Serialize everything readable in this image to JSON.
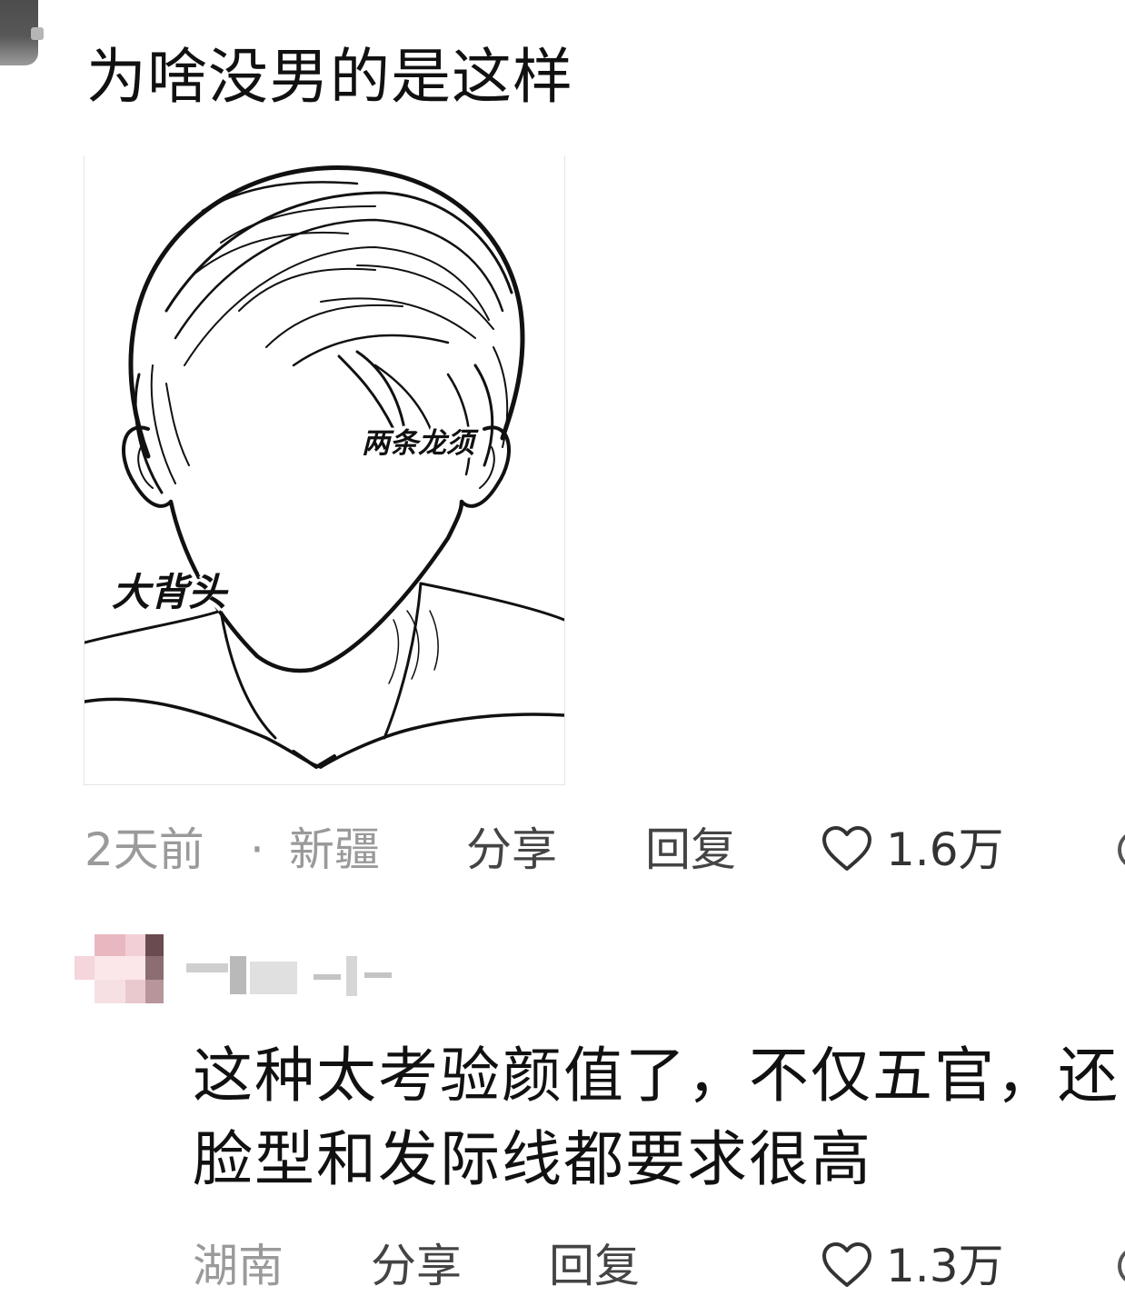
{
  "post": {
    "title": "为啥没男的是这样",
    "image": {
      "labels": {
        "forehead_strands": "两条龙须",
        "slicked_back": "大背头"
      }
    },
    "meta": {
      "time": "2天前",
      "separator": "·",
      "location": "新疆",
      "share_label": "分享",
      "reply_label": "回复",
      "likes": "1.6万"
    }
  },
  "comment": {
    "text_lines": [
      "这种太考验颜值了，不仅五官，还",
      "脸型和发际线都要求很高"
    ],
    "meta": {
      "location": "湖南",
      "share_label": "分享",
      "reply_label": "回复",
      "likes": "1.3万"
    }
  },
  "colors": {
    "meta_gray": "#9a9a9a",
    "action_dark": "#444444",
    "text_primary": "#111111"
  },
  "icons": [
    "heart-icon",
    "comment-icon"
  ]
}
